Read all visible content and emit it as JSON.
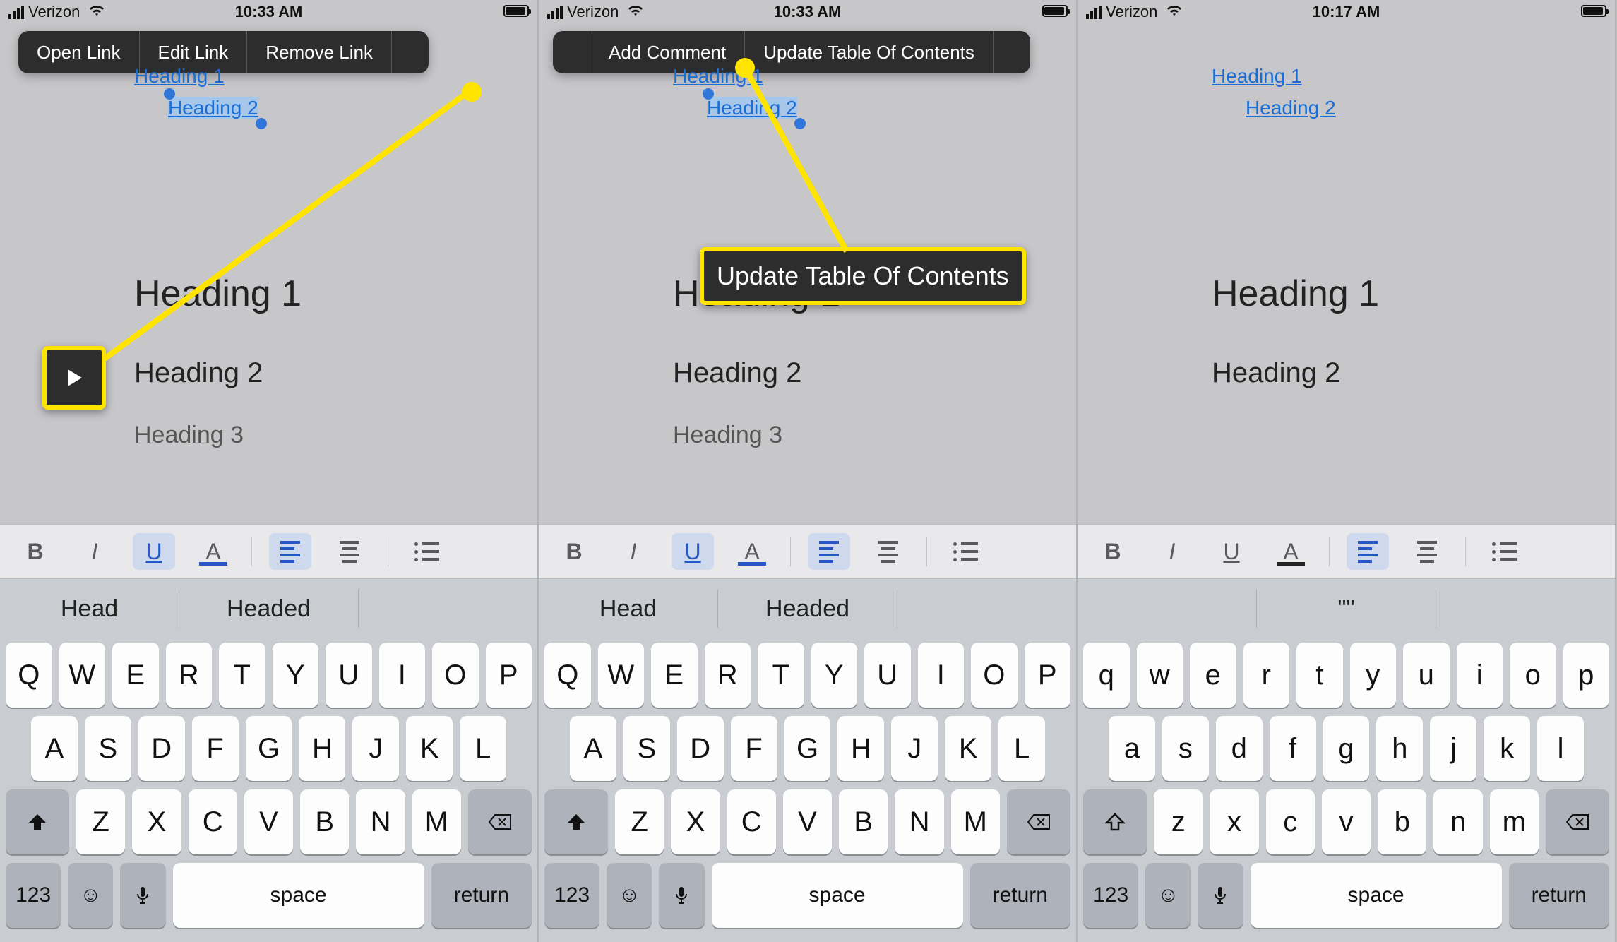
{
  "phones": [
    {
      "status": {
        "carrier": "Verizon",
        "time": "10:33 AM"
      },
      "menu": [
        "Open Link",
        "Edit Link",
        "Remove Link"
      ],
      "menu_arrow": "right",
      "toc": [
        "Heading 1",
        "Heading 2"
      ],
      "toc_selected_index": 1,
      "body": [
        "Heading 1",
        "Heading 2",
        "Heading 3"
      ],
      "underline_active": true,
      "text_color_blue": true,
      "suggestions": [
        "Head",
        "Headed",
        ""
      ],
      "keyboard_case": "upper",
      "callout_arrow": true
    },
    {
      "status": {
        "carrier": "Verizon",
        "time": "10:33 AM"
      },
      "menu": [
        "Add Comment",
        "Update Table Of Contents"
      ],
      "menu_arrow": "both",
      "toc": [
        "Heading 1",
        "Heading 2"
      ],
      "toc_selected_index": 1,
      "body": [
        "Heading 1",
        "Heading 2",
        "Heading 3"
      ],
      "underline_active": true,
      "text_color_blue": true,
      "suggestions": [
        "Head",
        "Headed",
        ""
      ],
      "keyboard_case": "upper",
      "callout_label": "Update Table Of Contents"
    },
    {
      "status": {
        "carrier": "Verizon",
        "time": "10:17 AM"
      },
      "menu": null,
      "toc": [
        "Heading 1",
        "Heading 2"
      ],
      "toc_selected_index": -1,
      "body": [
        "Heading 1",
        "Heading 2"
      ],
      "underline_active": false,
      "text_color_blue": false,
      "suggestions": [
        "",
        "\"\"",
        ""
      ],
      "keyboard_case": "lower"
    }
  ],
  "fmt": {
    "bold": "B",
    "italic": "I",
    "underline": "U",
    "textcolor": "A"
  },
  "kbd": {
    "rows_upper": [
      [
        "Q",
        "W",
        "E",
        "R",
        "T",
        "Y",
        "U",
        "I",
        "O",
        "P"
      ],
      [
        "A",
        "S",
        "D",
        "F",
        "G",
        "H",
        "J",
        "K",
        "L"
      ],
      [
        "Z",
        "X",
        "C",
        "V",
        "B",
        "N",
        "M"
      ]
    ],
    "rows_lower": [
      [
        "q",
        "w",
        "e",
        "r",
        "t",
        "y",
        "u",
        "i",
        "o",
        "p"
      ],
      [
        "a",
        "s",
        "d",
        "f",
        "g",
        "h",
        "j",
        "k",
        "l"
      ],
      [
        "z",
        "x",
        "c",
        "v",
        "b",
        "n",
        "m"
      ]
    ],
    "num": "123",
    "space": "space",
    "return": "return"
  }
}
